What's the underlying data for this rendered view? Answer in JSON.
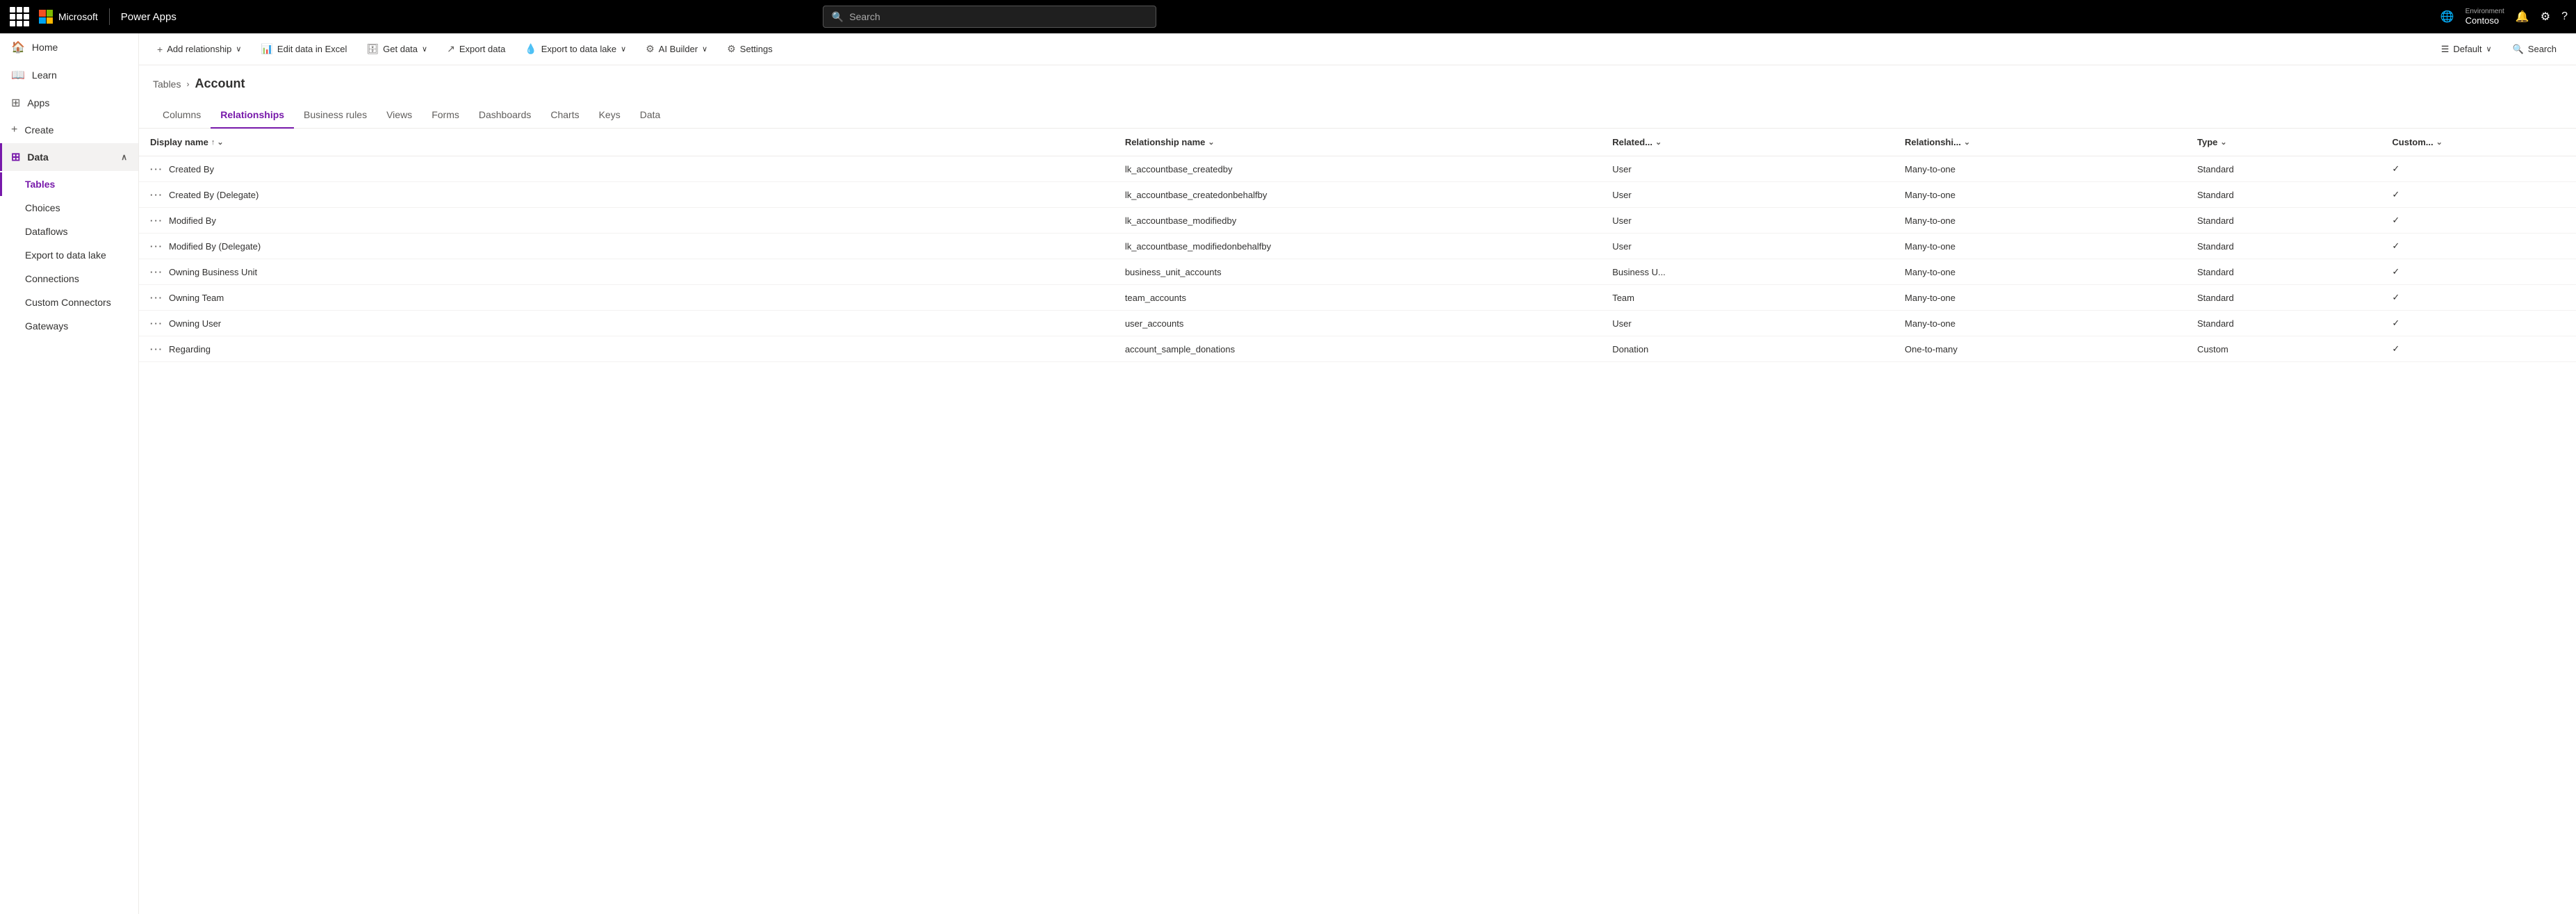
{
  "topbar": {
    "brand": "Microsoft",
    "appname": "Power Apps",
    "search_placeholder": "Search",
    "env_label": "Environment",
    "env_name": "Contoso"
  },
  "sidebar": {
    "items": [
      {
        "id": "home",
        "label": "Home",
        "icon": "🏠"
      },
      {
        "id": "learn",
        "label": "Learn",
        "icon": "📖"
      },
      {
        "id": "apps",
        "label": "Apps",
        "icon": "⊞"
      },
      {
        "id": "create",
        "label": "Create",
        "icon": "+"
      },
      {
        "id": "data",
        "label": "Data",
        "icon": "⊞",
        "expanded": true
      }
    ],
    "sub_items": [
      {
        "id": "tables",
        "label": "Tables",
        "active": true
      },
      {
        "id": "choices",
        "label": "Choices"
      },
      {
        "id": "dataflows",
        "label": "Dataflows"
      },
      {
        "id": "export-lake",
        "label": "Export to data lake"
      },
      {
        "id": "connections",
        "label": "Connections"
      },
      {
        "id": "custom-connectors",
        "label": "Custom Connectors"
      },
      {
        "id": "gateways",
        "label": "Gateways"
      }
    ]
  },
  "command_bar": {
    "add_relationship": "Add relationship",
    "edit_excel": "Edit data in Excel",
    "get_data": "Get data",
    "export_data": "Export data",
    "export_lake": "Export to data lake",
    "ai_builder": "AI Builder",
    "settings": "Settings",
    "default_label": "Default",
    "search_label": "Search"
  },
  "breadcrumb": {
    "parent": "Tables",
    "current": "Account"
  },
  "tabs": [
    {
      "id": "columns",
      "label": "Columns"
    },
    {
      "id": "relationships",
      "label": "Relationships",
      "active": true
    },
    {
      "id": "business-rules",
      "label": "Business rules"
    },
    {
      "id": "views",
      "label": "Views"
    },
    {
      "id": "forms",
      "label": "Forms"
    },
    {
      "id": "dashboards",
      "label": "Dashboards"
    },
    {
      "id": "charts",
      "label": "Charts"
    },
    {
      "id": "keys",
      "label": "Keys"
    },
    {
      "id": "data",
      "label": "Data"
    }
  ],
  "table": {
    "columns": [
      {
        "id": "display",
        "label": "Display name",
        "sort": "↑ ∨"
      },
      {
        "id": "relname",
        "label": "Relationship name",
        "sort": "∨"
      },
      {
        "id": "related",
        "label": "Related...",
        "sort": "∨"
      },
      {
        "id": "reltype",
        "label": "Relationshi...",
        "sort": "∨"
      },
      {
        "id": "type",
        "label": "Type",
        "sort": "∨"
      },
      {
        "id": "custom",
        "label": "Custom...",
        "sort": "∨"
      }
    ],
    "rows": [
      {
        "display": "Created By",
        "relname": "lk_accountbase_createdby",
        "related": "User",
        "reltype": "Many-to-one",
        "type": "Standard",
        "custom": true
      },
      {
        "display": "Created By (Delegate)",
        "relname": "lk_accountbase_createdonbehalfby",
        "related": "User",
        "reltype": "Many-to-one",
        "type": "Standard",
        "custom": true
      },
      {
        "display": "Modified By",
        "relname": "lk_accountbase_modifiedby",
        "related": "User",
        "reltype": "Many-to-one",
        "type": "Standard",
        "custom": true
      },
      {
        "display": "Modified By (Delegate)",
        "relname": "lk_accountbase_modifiedonbehalfby",
        "related": "User",
        "reltype": "Many-to-one",
        "type": "Standard",
        "custom": true
      },
      {
        "display": "Owning Business Unit",
        "relname": "business_unit_accounts",
        "related": "Business U...",
        "reltype": "Many-to-one",
        "type": "Standard",
        "custom": true
      },
      {
        "display": "Owning Team",
        "relname": "team_accounts",
        "related": "Team",
        "reltype": "Many-to-one",
        "type": "Standard",
        "custom": true
      },
      {
        "display": "Owning User",
        "relname": "user_accounts",
        "related": "User",
        "reltype": "Many-to-one",
        "type": "Standard",
        "custom": true
      },
      {
        "display": "Regarding",
        "relname": "account_sample_donations",
        "related": "Donation",
        "reltype": "One-to-many",
        "type": "Custom",
        "custom": true
      }
    ]
  }
}
